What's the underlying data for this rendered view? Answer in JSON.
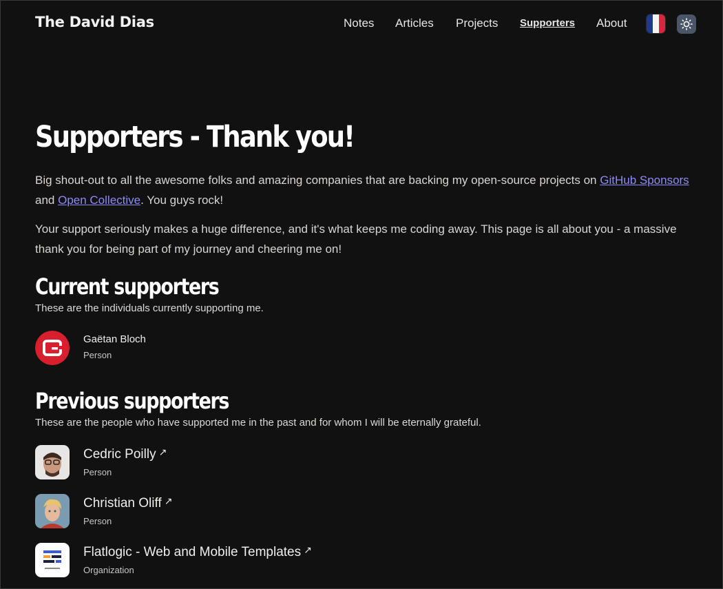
{
  "header": {
    "site_title": "The David Dias",
    "nav": [
      "Notes",
      "Articles",
      "Projects",
      "Supporters",
      "About"
    ],
    "active_nav": "Supporters",
    "language_flag": "france-flag-icon",
    "theme_toggle_icon": "sun-icon"
  },
  "main": {
    "title": "Supporters - Thank you!",
    "intro": {
      "p1_before": "Big shout-out to all the awesome folks and amazing companies that are backing my open-source projects on ",
      "link1": "GitHub Sponsors",
      "p1_middle": " and ",
      "link2": "Open Collective",
      "p1_after": ". You guys rock!",
      "p2": "Your support seriously makes a huge difference, and it's what keeps me coding away. This page is all about you - a massive thank you for being part of my journey and cheering me on!"
    },
    "current": {
      "title": "Current supporters",
      "subtitle": "These are the individuals currently supporting me.",
      "items": [
        {
          "name": "Gaëtan Bloch",
          "type": "Person"
        }
      ]
    },
    "previous": {
      "title": "Previous supporters",
      "subtitle": "These are the people who have supported me in the past and for whom I will be eternally grateful.",
      "items": [
        {
          "name": "Cedric Poilly",
          "type": "Person"
        },
        {
          "name": "Christian Oliff",
          "type": "Person"
        },
        {
          "name": "Flatlogic - Web and Mobile Templates",
          "type": "Organization"
        }
      ]
    }
  },
  "colors": {
    "background": "#121112",
    "link": "#8b8cf5",
    "theme_button": "#4a5568",
    "avatar_red": "#d71f2e"
  }
}
